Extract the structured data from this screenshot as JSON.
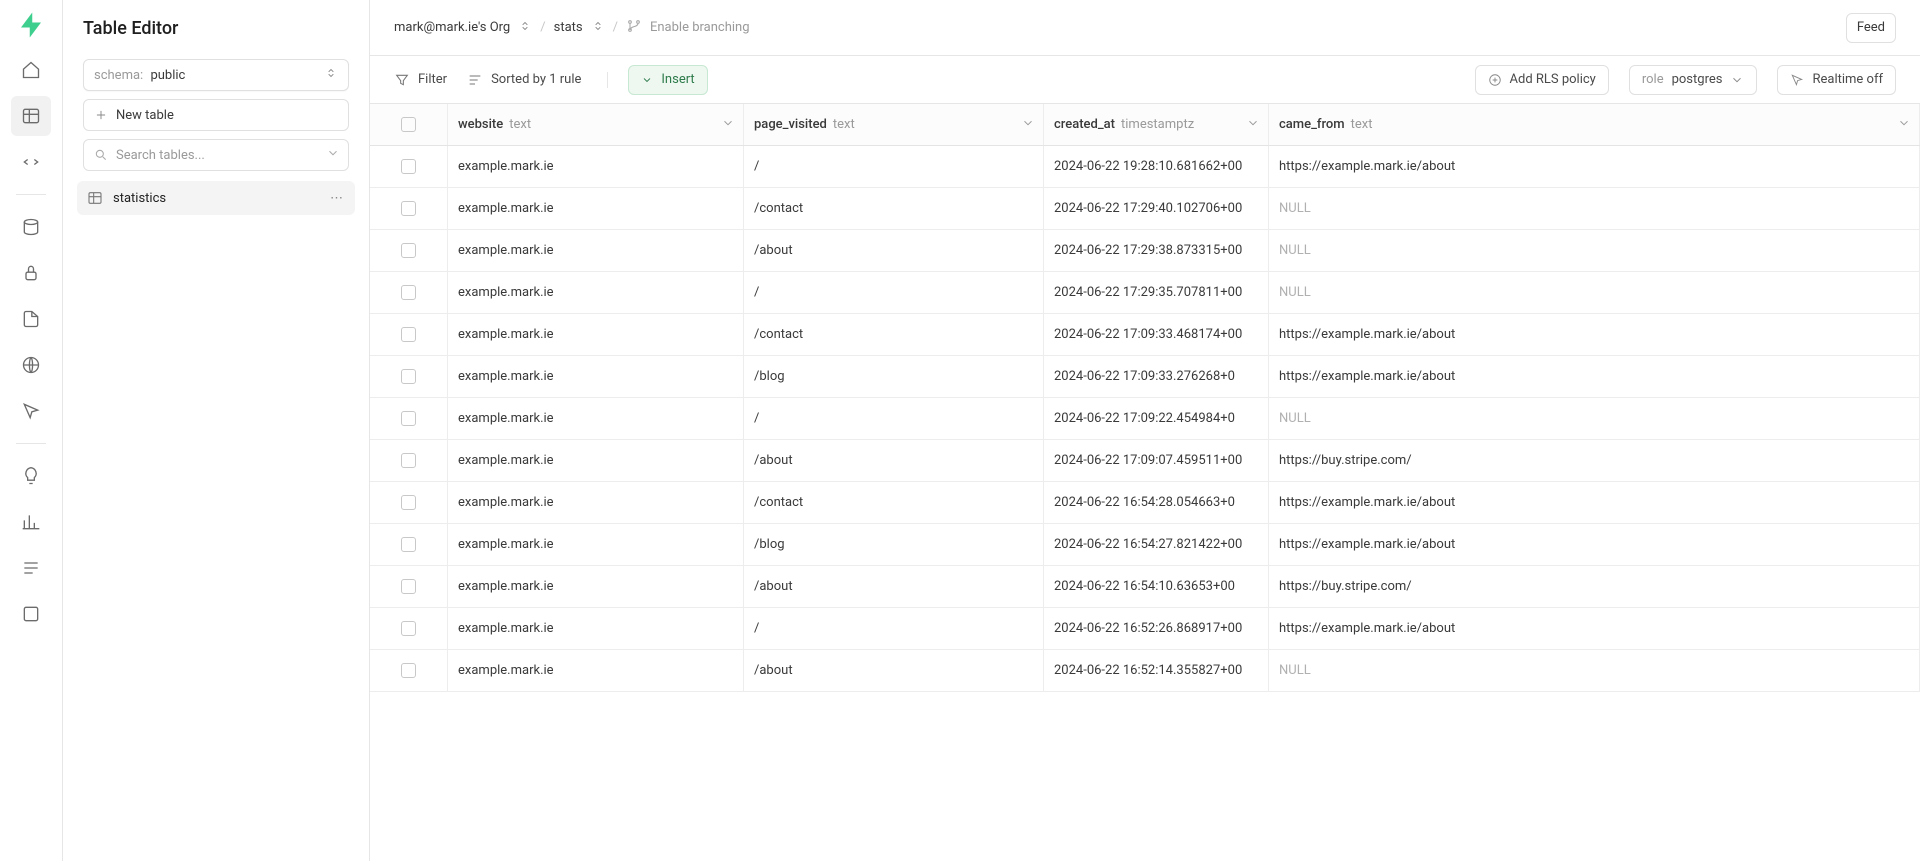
{
  "page_title": "Table Editor",
  "breadcrumb": {
    "org": "mark@mark.ie's Org",
    "project": "stats",
    "branching": "Enable branching"
  },
  "topbar": {
    "feed": "Feed"
  },
  "sidebar": {
    "schema_prefix": "schema:",
    "schema_value": "public",
    "new_table": "New table",
    "search_placeholder": "Search tables...",
    "selected_table": "statistics"
  },
  "toolbar": {
    "filter": "Filter",
    "sorted": "Sorted by 1 rule",
    "insert": "Insert",
    "rls": "Add RLS policy",
    "role_prefix": "role",
    "role_value": "postgres",
    "realtime": "Realtime off"
  },
  "columns": [
    {
      "name": "website",
      "type": "text"
    },
    {
      "name": "page_visited",
      "type": "text"
    },
    {
      "name": "created_at",
      "type": "timestamptz"
    },
    {
      "name": "came_from",
      "type": "text"
    }
  ],
  "rows": [
    {
      "website": "example.mark.ie",
      "page_visited": "/",
      "created_at": "2024-06-22 19:28:10.681662+00",
      "came_from": "https://example.mark.ie/about"
    },
    {
      "website": "example.mark.ie",
      "page_visited": "/contact",
      "created_at": "2024-06-22 17:29:40.102706+00",
      "came_from": null
    },
    {
      "website": "example.mark.ie",
      "page_visited": "/about",
      "created_at": "2024-06-22 17:29:38.873315+00",
      "came_from": null
    },
    {
      "website": "example.mark.ie",
      "page_visited": "/",
      "created_at": "2024-06-22 17:29:35.707811+00",
      "came_from": null
    },
    {
      "website": "example.mark.ie",
      "page_visited": "/contact",
      "created_at": "2024-06-22 17:09:33.468174+00",
      "came_from": "https://example.mark.ie/about"
    },
    {
      "website": "example.mark.ie",
      "page_visited": "/blog",
      "created_at": "2024-06-22 17:09:33.276268+0",
      "came_from": "https://example.mark.ie/about"
    },
    {
      "website": "example.mark.ie",
      "page_visited": "/",
      "created_at": "2024-06-22 17:09:22.454984+0",
      "came_from": null
    },
    {
      "website": "example.mark.ie",
      "page_visited": "/about",
      "created_at": "2024-06-22 17:09:07.459511+00",
      "came_from": "https://buy.stripe.com/"
    },
    {
      "website": "example.mark.ie",
      "page_visited": "/contact",
      "created_at": "2024-06-22 16:54:28.054663+0",
      "came_from": "https://example.mark.ie/about"
    },
    {
      "website": "example.mark.ie",
      "page_visited": "/blog",
      "created_at": "2024-06-22 16:54:27.821422+00",
      "came_from": "https://example.mark.ie/about"
    },
    {
      "website": "example.mark.ie",
      "page_visited": "/about",
      "created_at": "2024-06-22 16:54:10.63653+00",
      "came_from": "https://buy.stripe.com/"
    },
    {
      "website": "example.mark.ie",
      "page_visited": "/",
      "created_at": "2024-06-22 16:52:26.868917+00",
      "came_from": "https://example.mark.ie/about"
    },
    {
      "website": "example.mark.ie",
      "page_visited": "/about",
      "created_at": "2024-06-22 16:52:14.355827+00",
      "came_from": null
    }
  ]
}
